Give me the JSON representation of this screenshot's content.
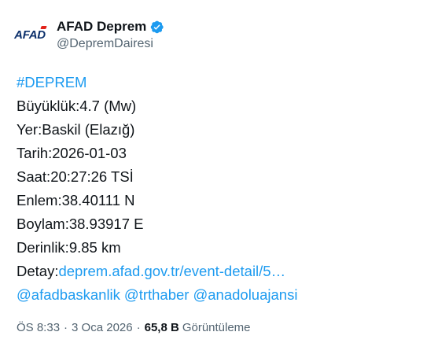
{
  "author": {
    "avatar_text": "AFAD",
    "display_name": "AFAD Deprem",
    "handle": "@DepremDairesi",
    "verified_color": "#1d9bf0"
  },
  "tweet": {
    "hashtag": "#DEPREM",
    "magnitude": "Büyüklük:4.7 (Mw)",
    "location": "Yer:Baskil (Elazığ)",
    "date": "Tarih:2026-01-03",
    "time": "Saat:20:27:26 TSİ",
    "latitude": "Enlem:38.40111 N",
    "longitude": "Boylam:38.93917 E",
    "depth": "Derinlik:9.85 km",
    "detail_label": "Detay:",
    "detail_link": "deprem.afad.gov.tr/event-detail/5…",
    "mentions": [
      "@afadbaskanlik",
      "@trthaber",
      "@anadoluajansi"
    ]
  },
  "meta": {
    "time": "ÖS 8:33",
    "date": "3 Oca 2026",
    "separator": "·",
    "views_count": "65,8 B",
    "views_label": "Görüntüleme"
  },
  "colors": {
    "link": "#1d9bf0",
    "text": "#0f1419",
    "secondary": "#536471",
    "logo_blue": "#0b2f6b",
    "logo_red": "#e2231a"
  }
}
